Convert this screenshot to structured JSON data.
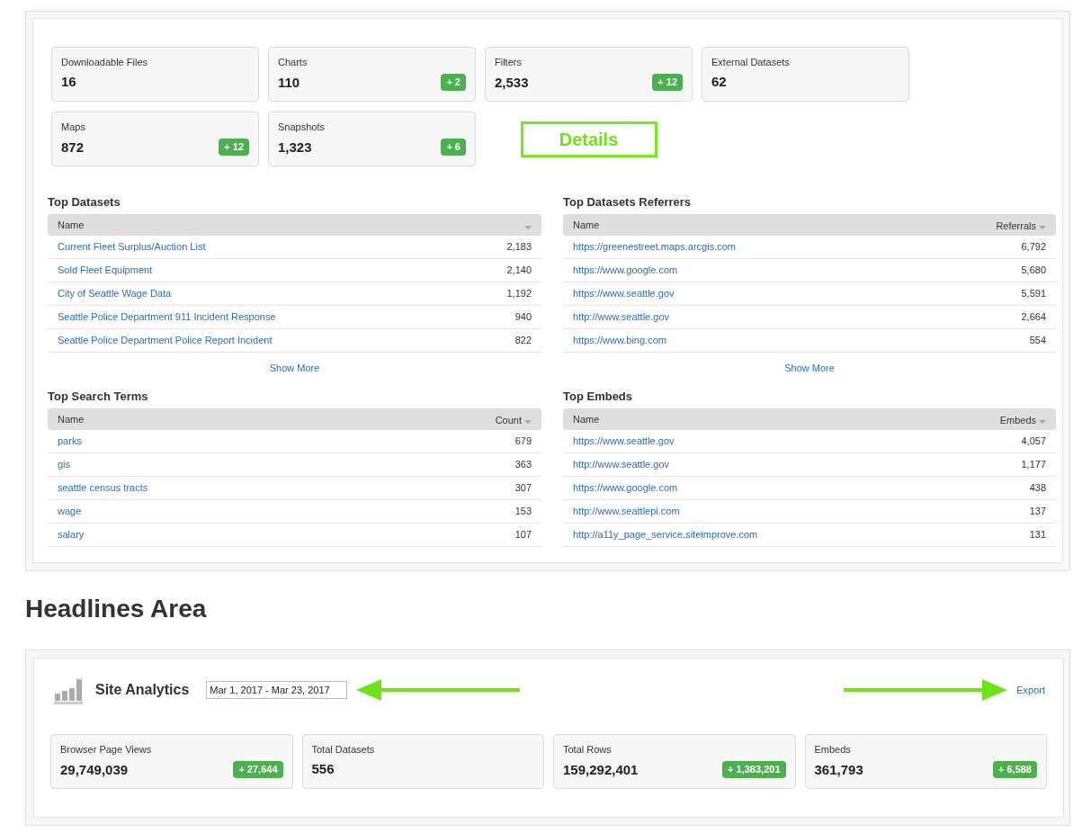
{
  "stats": [
    {
      "label": "Downloadable Files",
      "value": "16"
    },
    {
      "label": "Charts",
      "value": "110",
      "delta": "+ 2"
    },
    {
      "label": "Filters",
      "value": "2,533",
      "delta": "+ 12"
    },
    {
      "label": "External Datasets",
      "value": "62"
    },
    {
      "label": "Maps",
      "value": "872",
      "delta": "+ 12"
    },
    {
      "label": "Snapshots",
      "value": "1,323",
      "delta": "+ 6"
    }
  ],
  "details_label": "Details",
  "tables": [
    {
      "title": "Top Datasets",
      "columns": [
        "Name"
      ],
      "show_more": "Show More",
      "rows": [
        {
          "name": "Current Fleet Surplus/Auction List",
          "value": "2,183"
        },
        {
          "name": "Sold Fleet Equipment",
          "value": "2,140"
        },
        {
          "name": "City of Seattle Wage Data",
          "value": "1,192"
        },
        {
          "name": "Seattle Police Department 911 Incident Response",
          "value": "940"
        },
        {
          "name": "Seattle Police Department Police Report Incident",
          "value": "822"
        }
      ]
    },
    {
      "title": "Top Datasets Referrers",
      "columns": [
        "Name",
        "Referrals"
      ],
      "show_more": "Show More",
      "rows": [
        {
          "name": "https://greenestreet.maps.arcgis.com",
          "value": "6,792"
        },
        {
          "name": "https://www.google.com",
          "value": "5,680"
        },
        {
          "name": "https://www.seattle.gov",
          "value": "5,591"
        },
        {
          "name": "http://www.seattle.gov",
          "value": "2,664"
        },
        {
          "name": "https://www.bing.com",
          "value": "554"
        }
      ]
    },
    {
      "title": "Top Search Terms",
      "columns": [
        "Name",
        "Count"
      ],
      "rows": [
        {
          "name": "parks",
          "value": "679"
        },
        {
          "name": "gis",
          "value": "363"
        },
        {
          "name": "seattle census tracts",
          "value": "307"
        },
        {
          "name": "wage",
          "value": "153"
        },
        {
          "name": "salary",
          "value": "107"
        }
      ]
    },
    {
      "title": "Top Embeds",
      "columns": [
        "Name",
        "Embeds"
      ],
      "rows": [
        {
          "name": "https://www.seattle.gov",
          "value": "4,057"
        },
        {
          "name": "http://www.seattle.gov",
          "value": "1,177"
        },
        {
          "name": "https://www.google.com",
          "value": "438"
        },
        {
          "name": "http://www.seattlepi.com",
          "value": "137"
        },
        {
          "name": "http://a11y_page_service.siteimprove.com",
          "value": "131"
        }
      ]
    }
  ],
  "headline": "Headlines Area",
  "site_analytics": {
    "title": "Site Analytics",
    "date_range": "Mar 1, 2017 - Mar 23, 2017",
    "export": "Export",
    "stats": [
      {
        "label": "Browser Page Views",
        "value": "29,749,039",
        "delta": "+ 27,644"
      },
      {
        "label": "Total Datasets",
        "value": "556"
      },
      {
        "label": "Total Rows",
        "value": "159,292,401",
        "delta": "+ 1,383,201"
      },
      {
        "label": "Embeds",
        "value": "361,793",
        "delta": "+ 6,588"
      }
    ]
  }
}
